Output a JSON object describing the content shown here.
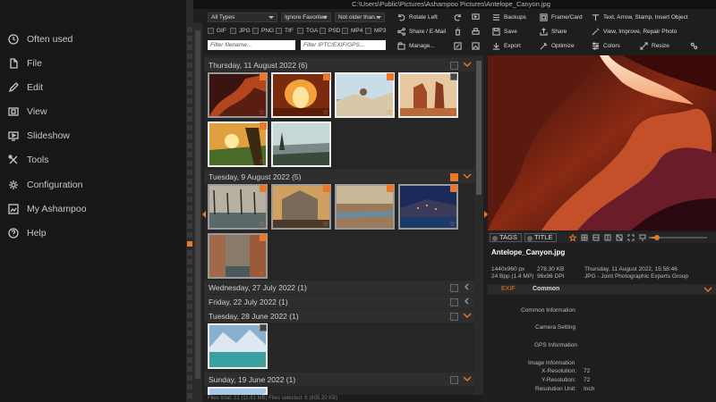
{
  "window": {
    "title": "C:\\Users\\Public\\Pictures\\Ashampoo Pictures\\Antelope_Canyon.jpg"
  },
  "menu": [
    {
      "label": "Often used",
      "icon": "clock-icon"
    },
    {
      "label": "File",
      "icon": "file-icon"
    },
    {
      "label": "Edit",
      "icon": "pencil-icon"
    },
    {
      "label": "View",
      "icon": "view-icon"
    },
    {
      "label": "Slideshow",
      "icon": "slideshow-icon"
    },
    {
      "label": "Tools",
      "icon": "tools-icon"
    },
    {
      "label": "Configuration",
      "icon": "gear-icon"
    },
    {
      "label": "My Ashampoo",
      "icon": "user-icon"
    },
    {
      "label": "Help",
      "icon": "help-icon"
    }
  ],
  "filters": {
    "type": "All Types",
    "favorites": "Ignore Favorites",
    "age": "Not older than...",
    "formats": [
      "GIF",
      "JPG",
      "PNG",
      "TIF",
      "TGA",
      "PSD",
      "MP4",
      "MP3"
    ],
    "filename_placeholder": "Filter filename...",
    "iptc_placeholder": "Filter IPTC/EXIF/GPS..."
  },
  "toolbar": {
    "rotate_left": "Rotate Left",
    "share_email": "Share / E-Mail",
    "manage": "Manage...",
    "backups": "Backups",
    "save": "Save",
    "export": "Export",
    "frame_card": "Frame/Card",
    "share": "Share",
    "optimize": "Optimize",
    "colors": "Colors",
    "text_arrow": "Text, Arrow, Stamp, Insert Object",
    "view_improve": "View, Improve, Repair Photo",
    "resize": "Resize"
  },
  "groups": [
    {
      "label": "Thursday, 11 August 2022 (6)",
      "checked": false,
      "expanded": true
    },
    {
      "label": "Tuesday, 9 August 2022 (5)",
      "checked": true,
      "expanded": true
    },
    {
      "label": "Wednesday, 27 July 2022 (1)",
      "checked": false,
      "expanded": false
    },
    {
      "label": "Friday, 22 July 2022 (1)",
      "checked": false,
      "expanded": false
    },
    {
      "label": "Tuesday, 28 June 2022 (1)",
      "checked": false,
      "expanded": true
    },
    {
      "label": "Sunday, 19 June 2022 (1)",
      "checked": false,
      "expanded": true
    }
  ],
  "status": "Files total: 21 (11.61 MB)   Files selected: 6 (805.20 KB)",
  "preview": {
    "tags_label": "TAGS",
    "title_label": "TITLE",
    "zoom": 0.1
  },
  "fileinfo": {
    "name": "Antelope_Canyon.jpg",
    "dimensions": "1440x960 px",
    "size": "278.30 KB",
    "date": "Thursday, 11 August 2022, 15:58:46",
    "bpp": "24 Bpp (1.4 MP)",
    "dpi": "96x96 DPI",
    "type": "JPG - Joint Photographic Experts Group"
  },
  "exif": {
    "tab_exif": "EXIF",
    "tab_common": "Common",
    "sections": [
      "Common Information",
      "Camera Setting",
      "GPS Information",
      "Image Information"
    ],
    "rows": [
      {
        "label": "X-Resolution:",
        "value": "72"
      },
      {
        "label": "Y-Resolution:",
        "value": "72"
      },
      {
        "label": "Resolution Unit:",
        "value": "Inch"
      }
    ]
  },
  "colors": {
    "accent": "#e8782a"
  }
}
